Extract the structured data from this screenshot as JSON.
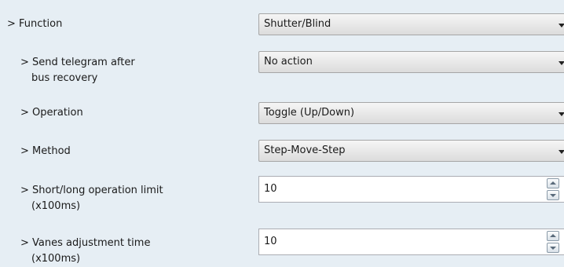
{
  "parameters": [
    {
      "label": "> Function",
      "control": "dropdown",
      "value": "Shutter/Blind"
    },
    {
      "label": "> Send telegram after",
      "label_line2": "bus recovery",
      "control": "dropdown",
      "value": "No action"
    },
    {
      "label": "> Operation",
      "control": "dropdown",
      "value": "Toggle (Up/Down)"
    },
    {
      "label": "> Method",
      "control": "dropdown",
      "value": "Step-Move-Step"
    },
    {
      "label": "> Short/long operation limit",
      "label_line2": "(x100ms)",
      "control": "number",
      "value": "10"
    },
    {
      "label": "> Vanes adjustment time",
      "label_line2": "(x100ms)",
      "control": "number",
      "value": "10"
    }
  ],
  "icons": {
    "dropdown_arrow": "chevron-down-icon",
    "spin_up": "spin-up-icon",
    "spin_down": "spin-down-icon"
  },
  "colors": {
    "panel_background": "#e6eef4",
    "field_background": "#ffffff",
    "field_border": "#abadb3",
    "combo_border": "#a6a6a6"
  }
}
